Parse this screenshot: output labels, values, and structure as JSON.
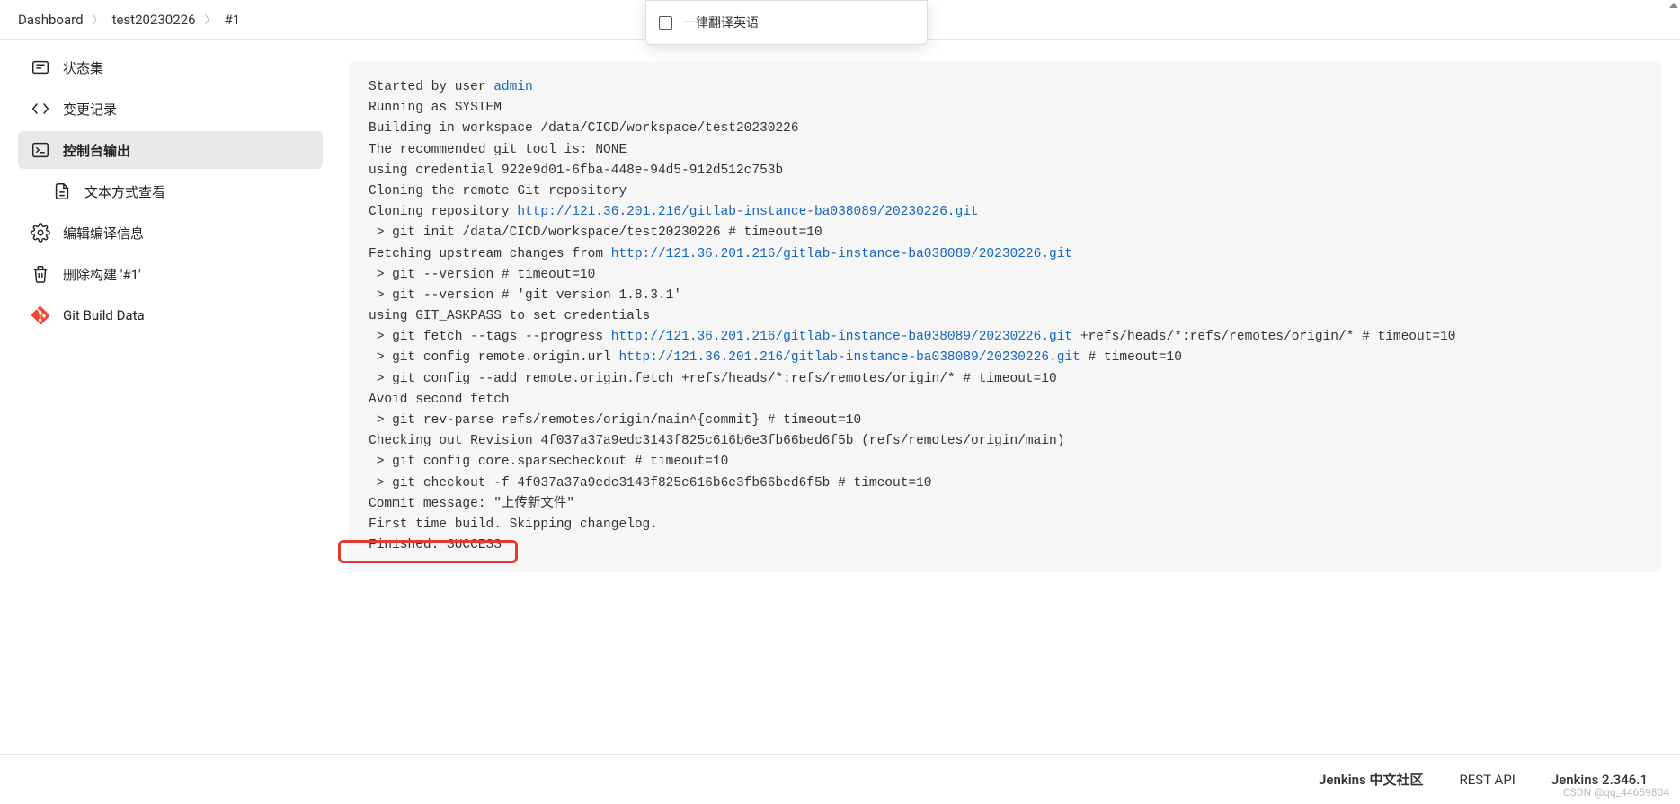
{
  "breadcrumb": {
    "items": [
      {
        "label": "Dashboard"
      },
      {
        "label": "test20230226"
      },
      {
        "label": "#1"
      }
    ]
  },
  "translate_popup": {
    "label": "一律翻译英语"
  },
  "sidebar": {
    "items": [
      {
        "icon": "status-icon",
        "label": "状态集",
        "active": false
      },
      {
        "icon": "changes-icon",
        "label": "变更记录",
        "active": false
      },
      {
        "icon": "terminal-icon",
        "label": "控制台输出",
        "active": true
      },
      {
        "icon": "text-icon",
        "label": "文本方式查看",
        "sub": true,
        "active": false
      },
      {
        "icon": "gear-icon",
        "label": "编辑编译信息",
        "active": false
      },
      {
        "icon": "trash-icon",
        "label": "删除构建 '#1'",
        "active": false
      },
      {
        "icon": "git-icon",
        "label": "Git Build Data",
        "git": true,
        "active": false
      }
    ]
  },
  "console": {
    "lines": [
      {
        "t": "Started by user ",
        "link": "admin",
        "after": ""
      },
      {
        "t": "Running as SYSTEM"
      },
      {
        "t": "Building in workspace /data/CICD/workspace/test20230226"
      },
      {
        "t": "The recommended git tool is: NONE"
      },
      {
        "t": "using credential 922e9d01-6fba-448e-94d5-912d512c753b"
      },
      {
        "t": "Cloning the remote Git repository"
      },
      {
        "t": "Cloning repository ",
        "link": "http://121.36.201.216/gitlab-instance-ba038089/20230226.git",
        "after": ""
      },
      {
        "t": " > git init /data/CICD/workspace/test20230226 # timeout=10"
      },
      {
        "t": "Fetching upstream changes from ",
        "link": "http://121.36.201.216/gitlab-instance-ba038089/20230226.git",
        "after": ""
      },
      {
        "t": " > git --version # timeout=10"
      },
      {
        "t": " > git --version # 'git version 1.8.3.1'"
      },
      {
        "t": "using GIT_ASKPASS to set credentials "
      },
      {
        "t": " > git fetch --tags --progress ",
        "link": "http://121.36.201.216/gitlab-instance-ba038089/20230226.git",
        "after": " +refs/heads/*:refs/remotes/origin/* # timeout=10"
      },
      {
        "t": " > git config remote.origin.url ",
        "link": "http://121.36.201.216/gitlab-instance-ba038089/20230226.git",
        "after": " # timeout=10"
      },
      {
        "t": " > git config --add remote.origin.fetch +refs/heads/*:refs/remotes/origin/* # timeout=10"
      },
      {
        "t": "Avoid second fetch"
      },
      {
        "t": " > git rev-parse refs/remotes/origin/main^{commit} # timeout=10"
      },
      {
        "t": "Checking out Revision 4f037a37a9edc3143f825c616b6e3fb66bed6f5b (refs/remotes/origin/main)"
      },
      {
        "t": " > git config core.sparsecheckout # timeout=10"
      },
      {
        "t": " > git checkout -f 4f037a37a9edc3143f825c616b6e3fb66bed6f5b # timeout=10"
      },
      {
        "t": "Commit message: \"上传新文件\""
      },
      {
        "t": "First time build. Skipping changelog."
      },
      {
        "t": "Finished: SUCCESS"
      }
    ]
  },
  "footer": {
    "community": "Jenkins 中文社区",
    "rest": "REST API",
    "version": "Jenkins 2.346.1"
  },
  "watermark": "CSDN @qq_44659804"
}
